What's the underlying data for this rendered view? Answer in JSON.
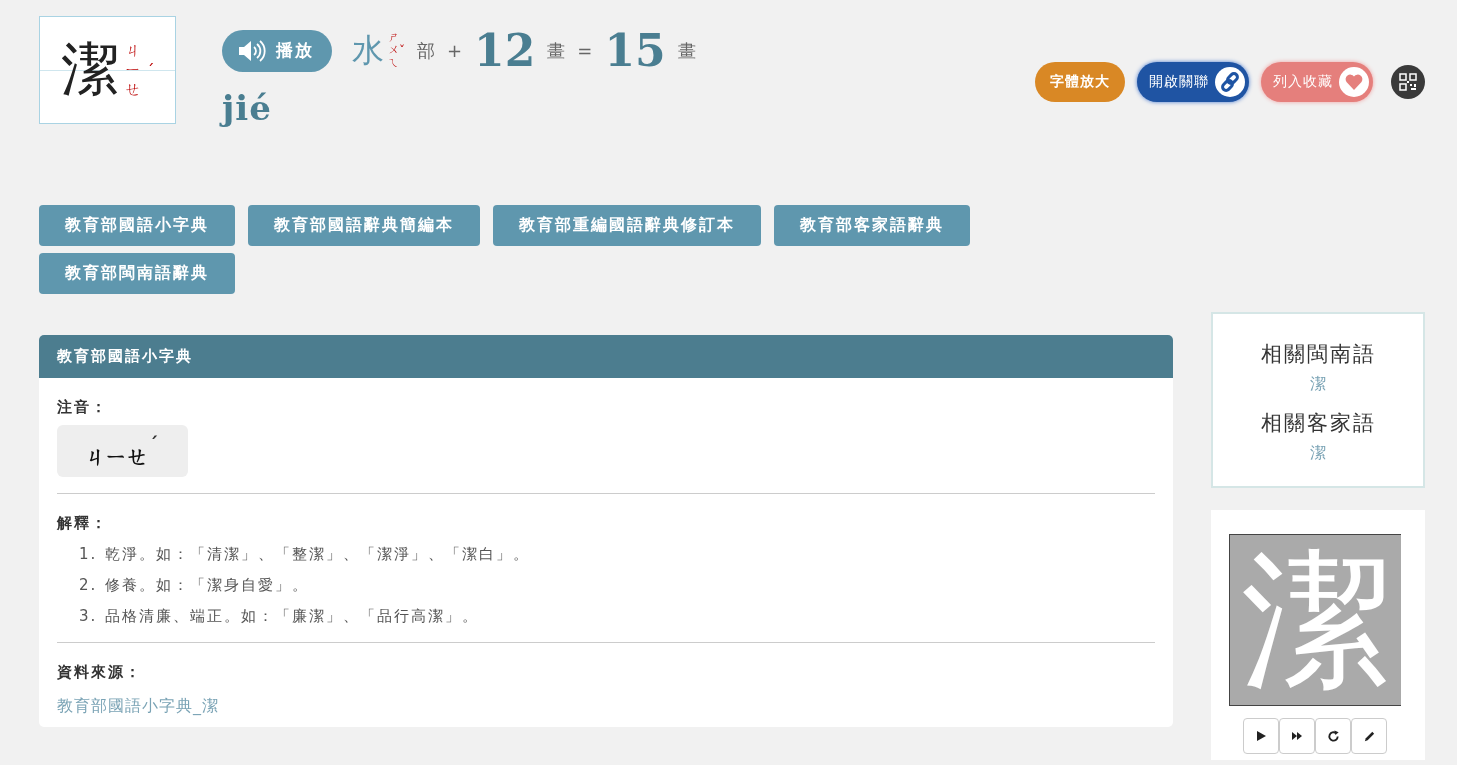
{
  "header": {
    "character": "潔",
    "side_zhuyin": [
      "ㄐ",
      "ㄧ",
      "ㄝ"
    ],
    "side_tone": "ˊ",
    "play_button": "播放",
    "radical": "水",
    "radical_zhuyin": [
      "ㄕ",
      "ㄨ",
      "ㄟ"
    ],
    "radical_tone": "ˇ",
    "radical_suffix": "部",
    "plus": "+",
    "extra_strokes": "12",
    "extra_unit": "畫",
    "equals": "=",
    "total_strokes": "15",
    "total_unit": "畫",
    "pinyin": "jié"
  },
  "actions": [
    {
      "label": "字體放大",
      "kind": "plain"
    },
    {
      "label": "開啟關聯",
      "kind": "link"
    },
    {
      "label": "列入收藏",
      "kind": "heart"
    }
  ],
  "dictionary_tabs": [
    "教育部國語小字典",
    "教育部國語辭典簡編本",
    "教育部重編國語辭典修訂本",
    "教育部客家語辭典",
    "教育部閩南語辭典"
  ],
  "entry": {
    "title": "教育部國語小字典",
    "zhuyin_label": "注音：",
    "zhuyin": "ㄐㄧㄝ",
    "zhuyin_tone": "ˊ",
    "definition_label": "解釋：",
    "definitions": [
      {
        "number": "1.",
        "text": "乾淨。如：「清潔」、「整潔」、「潔淨」、「潔白」。"
      },
      {
        "number": "2.",
        "text": "修養。如：「潔身自愛」。"
      },
      {
        "number": "3.",
        "text": "品格清廉、端正。如：「廉潔」、「品行高潔」。"
      }
    ],
    "source_label": "資料來源：",
    "source_link": "教育部國語小字典_潔"
  },
  "related": [
    {
      "heading": "相關閩南語",
      "link": "潔"
    },
    {
      "heading": "相關客家語",
      "link": "潔"
    }
  ],
  "stroke_panel": {
    "character": "潔",
    "controls": [
      {
        "kind": "play"
      },
      {
        "kind": "fast-forward"
      },
      {
        "kind": "replay"
      },
      {
        "kind": "pencil"
      }
    ]
  }
}
